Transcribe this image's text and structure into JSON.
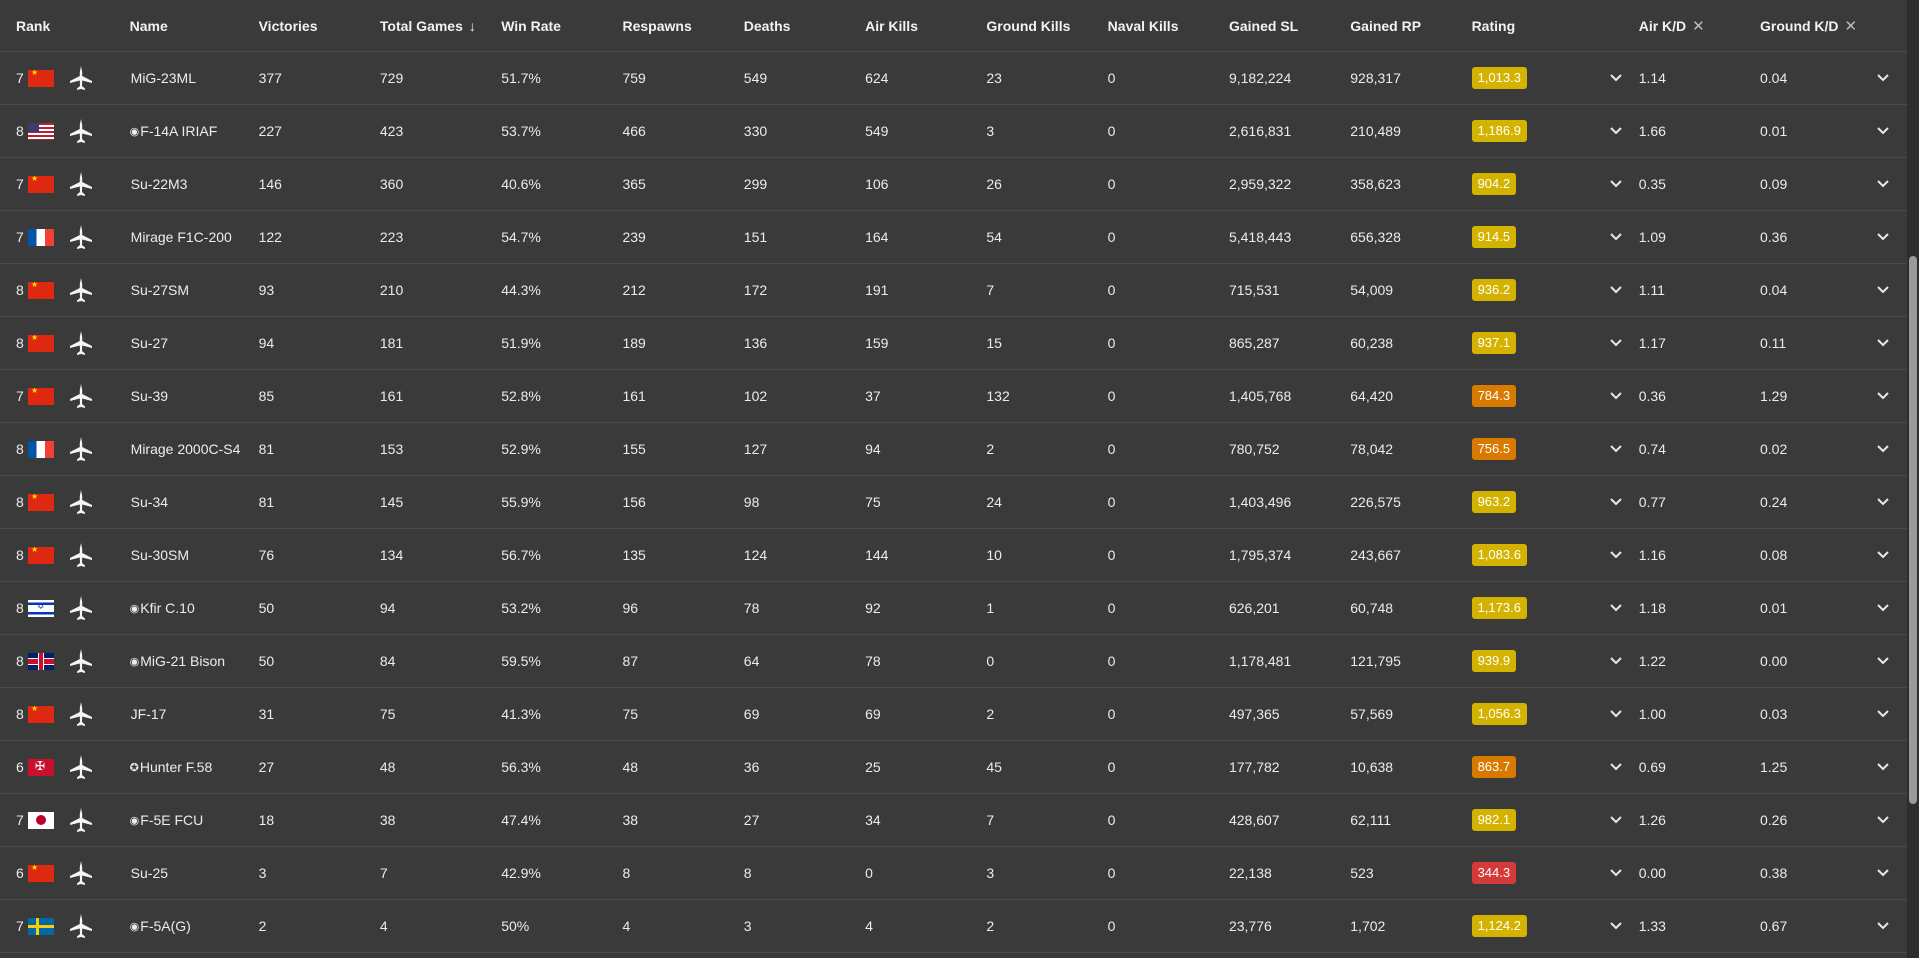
{
  "headers": {
    "rank": "Rank",
    "name": "Name",
    "victories": "Victories",
    "total_games": "Total Games",
    "win_rate": "Win Rate",
    "respawns": "Respawns",
    "deaths": "Deaths",
    "air_kills": "Air Kills",
    "ground_kills": "Ground Kills",
    "naval_kills": "Naval Kills",
    "gained_sl": "Gained SL",
    "gained_rp": "Gained RP",
    "rating": "Rating",
    "air_kd": "Air K/D",
    "ground_kd": "Ground K/D"
  },
  "icons": {
    "sort": "arrow-down-icon",
    "remove": "close-icon",
    "expand": "chevron-down-icon",
    "vehicle": "plane-icon"
  },
  "colors": {
    "yellow": "#d4b300",
    "orange": "#d97a00",
    "red": "#d43a3a"
  },
  "rows": [
    {
      "rank": "7",
      "nation": "china",
      "name": "MiG-23ML",
      "prefix": "",
      "victories": "377",
      "total_games": "729",
      "win_rate": "51.7%",
      "respawns": "759",
      "deaths": "549",
      "air_kills": "624",
      "ground_kills": "23",
      "naval_kills": "0",
      "gained_sl": "9,182,224",
      "gained_rp": "928,317",
      "rating": "1,013.3",
      "rating_color": "yellow",
      "air_kd": "1.14",
      "ground_kd": "0.04"
    },
    {
      "rank": "8",
      "nation": "usa",
      "name": "F-14A IRIAF",
      "prefix": "◉",
      "victories": "227",
      "total_games": "423",
      "win_rate": "53.7%",
      "respawns": "466",
      "deaths": "330",
      "air_kills": "549",
      "ground_kills": "3",
      "naval_kills": "0",
      "gained_sl": "2,616,831",
      "gained_rp": "210,489",
      "rating": "1,186.9",
      "rating_color": "yellow",
      "air_kd": "1.66",
      "ground_kd": "0.01"
    },
    {
      "rank": "7",
      "nation": "china",
      "name": "Su-22M3",
      "prefix": "",
      "victories": "146",
      "total_games": "360",
      "win_rate": "40.6%",
      "respawns": "365",
      "deaths": "299",
      "air_kills": "106",
      "ground_kills": "26",
      "naval_kills": "0",
      "gained_sl": "2,959,322",
      "gained_rp": "358,623",
      "rating": "904.2",
      "rating_color": "yellow",
      "air_kd": "0.35",
      "ground_kd": "0.09"
    },
    {
      "rank": "7",
      "nation": "france",
      "name": "Mirage F1C-200",
      "prefix": "",
      "victories": "122",
      "total_games": "223",
      "win_rate": "54.7%",
      "respawns": "239",
      "deaths": "151",
      "air_kills": "164",
      "ground_kills": "54",
      "naval_kills": "0",
      "gained_sl": "5,418,443",
      "gained_rp": "656,328",
      "rating": "914.5",
      "rating_color": "yellow",
      "air_kd": "1.09",
      "ground_kd": "0.36"
    },
    {
      "rank": "8",
      "nation": "china",
      "name": "Su-27SM",
      "prefix": "",
      "victories": "93",
      "total_games": "210",
      "win_rate": "44.3%",
      "respawns": "212",
      "deaths": "172",
      "air_kills": "191",
      "ground_kills": "7",
      "naval_kills": "0",
      "gained_sl": "715,531",
      "gained_rp": "54,009",
      "rating": "936.2",
      "rating_color": "yellow",
      "air_kd": "1.11",
      "ground_kd": "0.04"
    },
    {
      "rank": "8",
      "nation": "china",
      "name": "Su-27",
      "prefix": "",
      "victories": "94",
      "total_games": "181",
      "win_rate": "51.9%",
      "respawns": "189",
      "deaths": "136",
      "air_kills": "159",
      "ground_kills": "15",
      "naval_kills": "0",
      "gained_sl": "865,287",
      "gained_rp": "60,238",
      "rating": "937.1",
      "rating_color": "yellow",
      "air_kd": "1.17",
      "ground_kd": "0.11"
    },
    {
      "rank": "7",
      "nation": "china",
      "name": "Su-39",
      "prefix": "",
      "victories": "85",
      "total_games": "161",
      "win_rate": "52.8%",
      "respawns": "161",
      "deaths": "102",
      "air_kills": "37",
      "ground_kills": "132",
      "naval_kills": "0",
      "gained_sl": "1,405,768",
      "gained_rp": "64,420",
      "rating": "784.3",
      "rating_color": "orange",
      "air_kd": "0.36",
      "ground_kd": "1.29"
    },
    {
      "rank": "8",
      "nation": "france",
      "name": "Mirage 2000C-S4",
      "prefix": "",
      "victories": "81",
      "total_games": "153",
      "win_rate": "52.9%",
      "respawns": "155",
      "deaths": "127",
      "air_kills": "94",
      "ground_kills": "2",
      "naval_kills": "0",
      "gained_sl": "780,752",
      "gained_rp": "78,042",
      "rating": "756.5",
      "rating_color": "orange",
      "air_kd": "0.74",
      "ground_kd": "0.02"
    },
    {
      "rank": "8",
      "nation": "china",
      "name": "Su-34",
      "prefix": "",
      "victories": "81",
      "total_games": "145",
      "win_rate": "55.9%",
      "respawns": "156",
      "deaths": "98",
      "air_kills": "75",
      "ground_kills": "24",
      "naval_kills": "0",
      "gained_sl": "1,403,496",
      "gained_rp": "226,575",
      "rating": "963.2",
      "rating_color": "yellow",
      "air_kd": "0.77",
      "ground_kd": "0.24"
    },
    {
      "rank": "8",
      "nation": "china",
      "name": "Su-30SM",
      "prefix": "",
      "victories": "76",
      "total_games": "134",
      "win_rate": "56.7%",
      "respawns": "135",
      "deaths": "124",
      "air_kills": "144",
      "ground_kills": "10",
      "naval_kills": "0",
      "gained_sl": "1,795,374",
      "gained_rp": "243,667",
      "rating": "1,083.6",
      "rating_color": "yellow",
      "air_kd": "1.16",
      "ground_kd": "0.08"
    },
    {
      "rank": "8",
      "nation": "israel",
      "name": "Kfir C.10",
      "prefix": "◉",
      "victories": "50",
      "total_games": "94",
      "win_rate": "53.2%",
      "respawns": "96",
      "deaths": "78",
      "air_kills": "92",
      "ground_kills": "1",
      "naval_kills": "0",
      "gained_sl": "626,201",
      "gained_rp": "60,748",
      "rating": "1,173.6",
      "rating_color": "yellow",
      "air_kd": "1.18",
      "ground_kd": "0.01"
    },
    {
      "rank": "8",
      "nation": "uk",
      "name": "MiG-21 Bison",
      "prefix": "◉",
      "victories": "50",
      "total_games": "84",
      "win_rate": "59.5%",
      "respawns": "87",
      "deaths": "64",
      "air_kills": "78",
      "ground_kills": "0",
      "naval_kills": "0",
      "gained_sl": "1,178,481",
      "gained_rp": "121,795",
      "rating": "939.9",
      "rating_color": "yellow",
      "air_kd": "1.22",
      "ground_kd": "0.00"
    },
    {
      "rank": "8",
      "nation": "china",
      "name": "JF-17",
      "prefix": "",
      "victories": "31",
      "total_games": "75",
      "win_rate": "41.3%",
      "respawns": "75",
      "deaths": "69",
      "air_kills": "69",
      "ground_kills": "2",
      "naval_kills": "0",
      "gained_sl": "497,365",
      "gained_rp": "57,569",
      "rating": "1,056.3",
      "rating_color": "yellow",
      "air_kd": "1.00",
      "ground_kd": "0.03"
    },
    {
      "rank": "6",
      "nation": "germany",
      "name": "Hunter F.58",
      "prefix": "✪",
      "victories": "27",
      "total_games": "48",
      "win_rate": "56.3%",
      "respawns": "48",
      "deaths": "36",
      "air_kills": "25",
      "ground_kills": "45",
      "naval_kills": "0",
      "gained_sl": "177,782",
      "gained_rp": "10,638",
      "rating": "863.7",
      "rating_color": "orange",
      "air_kd": "0.69",
      "ground_kd": "1.25"
    },
    {
      "rank": "7",
      "nation": "japan",
      "name": "F-5E FCU",
      "prefix": "◉",
      "victories": "18",
      "total_games": "38",
      "win_rate": "47.4%",
      "respawns": "38",
      "deaths": "27",
      "air_kills": "34",
      "ground_kills": "7",
      "naval_kills": "0",
      "gained_sl": "428,607",
      "gained_rp": "62,111",
      "rating": "982.1",
      "rating_color": "yellow",
      "air_kd": "1.26",
      "ground_kd": "0.26"
    },
    {
      "rank": "6",
      "nation": "china",
      "name": "Su-25",
      "prefix": "",
      "victories": "3",
      "total_games": "7",
      "win_rate": "42.9%",
      "respawns": "8",
      "deaths": "8",
      "air_kills": "0",
      "ground_kills": "3",
      "naval_kills": "0",
      "gained_sl": "22,138",
      "gained_rp": "523",
      "rating": "344.3",
      "rating_color": "red",
      "air_kd": "0.00",
      "ground_kd": "0.38"
    },
    {
      "rank": "7",
      "nation": "sweden",
      "name": "F-5A(G)",
      "prefix": "◉",
      "victories": "2",
      "total_games": "4",
      "win_rate": "50%",
      "respawns": "4",
      "deaths": "3",
      "air_kills": "4",
      "ground_kills": "2",
      "naval_kills": "0",
      "gained_sl": "23,776",
      "gained_rp": "1,702",
      "rating": "1,124.2",
      "rating_color": "yellow",
      "air_kd": "1.33",
      "ground_kd": "0.67"
    }
  ]
}
